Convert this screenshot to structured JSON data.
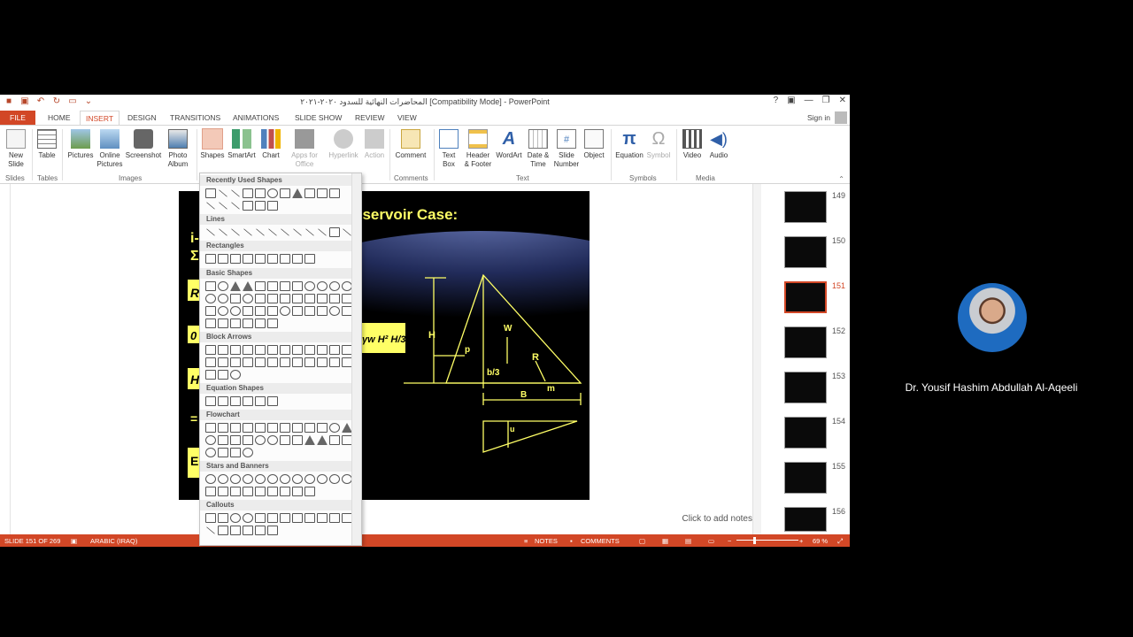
{
  "window": {
    "title": "المحاضرات النهائية للسدود ٢٠٢٠-٢٠٢١ [Compatibility Mode] - PowerPoint",
    "help": "?",
    "minimize": "—",
    "restore": "❐",
    "close": "✕"
  },
  "tabs": [
    "FILE",
    "HOME",
    "INSERT",
    "DESIGN",
    "TRANSITIONS",
    "ANIMATIONS",
    "SLIDE SHOW",
    "REVIEW",
    "VIEW"
  ],
  "active_tab": "INSERT",
  "sign_in": "Sign in",
  "ribbon": {
    "new_slide": "New\nSlide",
    "table": "Table",
    "pictures": "Pictures",
    "online_pictures": "Online\nPictures",
    "screenshot": "Screenshot",
    "photo_album": "Photo\nAlbum",
    "shapes": "Shapes",
    "smartart": "SmartArt",
    "chart": "Chart",
    "apps_for_office": "Apps for\nOffice",
    "hyperlink": "Hyperlink",
    "action": "Action",
    "comment": "Comment",
    "text_box": "Text\nBox",
    "header_footer": "Header\n& Footer",
    "wordart": "WordArt",
    "date_time": "Date &\nTime",
    "slide_number": "Slide\nNumber",
    "object": "Object",
    "equation": "Equation",
    "symbol": "Symbol",
    "video": "Video",
    "audio": "Audio",
    "groups": {
      "slides": "Slides",
      "tables": "Tables",
      "images": "Images",
      "comments": "Comments",
      "text": "Text",
      "symbols": "Symbols",
      "media": "Media"
    }
  },
  "gallery": {
    "sections": [
      "Recently Used Shapes",
      "Lines",
      "Rectangles",
      "Basic Shapes",
      "Block Arrows",
      "Equation Shapes",
      "Flowchart",
      "Stars and Banners",
      "Callouts"
    ]
  },
  "slide": {
    "title": "eservoir Case:",
    "left_letters": [
      "i-",
      "Σ",
      "R",
      "0",
      "H",
      "=",
      "E"
    ],
    "formula": "γw H²  H/3",
    "labels": {
      "H": "H",
      "W": "W",
      "p": "p",
      "R": "R",
      "b3": "b/3",
      "m": "m",
      "B": "B",
      "u": "u"
    }
  },
  "notes_placeholder": "Click to add notes",
  "thumbnails": [
    "149",
    "150",
    "151",
    "152",
    "153",
    "154",
    "155",
    "156"
  ],
  "selected_thumbnail": "151",
  "status": {
    "slide": "SLIDE 151 OF 269",
    "language": "ARABIC (IRAQ)",
    "notes": "NOTES",
    "comments": "COMMENTS",
    "zoom": "69 %"
  },
  "presenter": {
    "name": "Dr. Yousif Hashim Abdullah Al-Aqeeli"
  },
  "colors": {
    "accent": "#d24726",
    "slide_text": "#ffff66"
  }
}
